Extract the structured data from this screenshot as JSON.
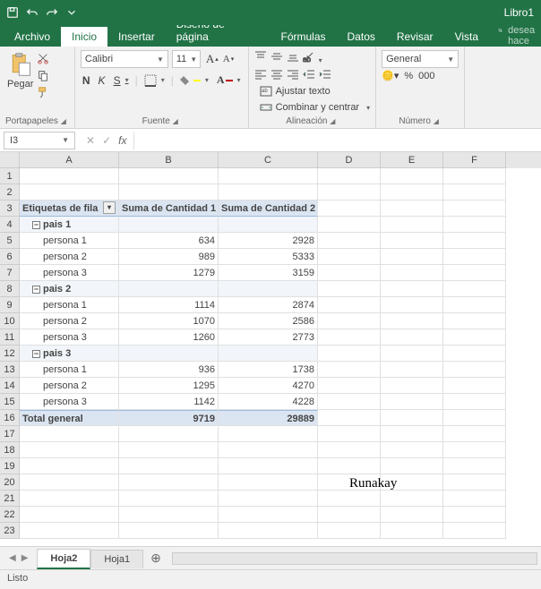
{
  "titlebar": {
    "title": "Libro1"
  },
  "menu": {
    "file": "Archivo",
    "home": "Inicio",
    "insert": "Insertar",
    "page_layout": "Diseño de página",
    "formulas": "Fórmulas",
    "data": "Datos",
    "review": "Revisar",
    "view": "Vista",
    "tellme": "¿Qué desea hace"
  },
  "ribbon": {
    "clipboard": {
      "paste": "Pegar",
      "label": "Portapapeles"
    },
    "font": {
      "name": "Calibri",
      "size": "11",
      "label": "Fuente",
      "bold": "N",
      "italic": "K",
      "underline": "S"
    },
    "align": {
      "wrap": "Ajustar texto",
      "merge": "Combinar y centrar",
      "label": "Alineación"
    },
    "number": {
      "format": "General",
      "label": "Número"
    }
  },
  "formula": {
    "namebox": "I3",
    "fx": "fx"
  },
  "columns": [
    "A",
    "B",
    "C",
    "D",
    "E",
    "F"
  ],
  "rows": [
    "1",
    "2",
    "3",
    "4",
    "5",
    "6",
    "7",
    "8",
    "9",
    "10",
    "11",
    "12",
    "13",
    "14",
    "15",
    "16",
    "17",
    "18",
    "19",
    "20",
    "21",
    "22",
    "23"
  ],
  "pivot": {
    "hdr_rows": "Etiquetas de fila",
    "hdr_c1": "Suma de Cantidad 1",
    "hdr_c2": "Suma de Cantidad 2",
    "groups": [
      {
        "name": "pais 1",
        "rows": [
          {
            "label": "persona 1",
            "c1": "634",
            "c2": "2928"
          },
          {
            "label": "persona 2",
            "c1": "989",
            "c2": "5333"
          },
          {
            "label": "persona 3",
            "c1": "1279",
            "c2": "3159"
          }
        ]
      },
      {
        "name": "pais 2",
        "rows": [
          {
            "label": "persona 1",
            "c1": "1114",
            "c2": "2874"
          },
          {
            "label": "persona 2",
            "c1": "1070",
            "c2": "2586"
          },
          {
            "label": "persona 3",
            "c1": "1260",
            "c2": "2773"
          }
        ]
      },
      {
        "name": "pais 3",
        "rows": [
          {
            "label": "persona 1",
            "c1": "936",
            "c2": "1738"
          },
          {
            "label": "persona 2",
            "c1": "1295",
            "c2": "4270"
          },
          {
            "label": "persona 3",
            "c1": "1142",
            "c2": "4228"
          }
        ]
      }
    ],
    "total_label": "Total general",
    "total_c1": "9719",
    "total_c2": "29889"
  },
  "watermark": "Runakay",
  "sheets": {
    "active": "Hoja2",
    "other": "Hoja1"
  },
  "status": "Listo"
}
